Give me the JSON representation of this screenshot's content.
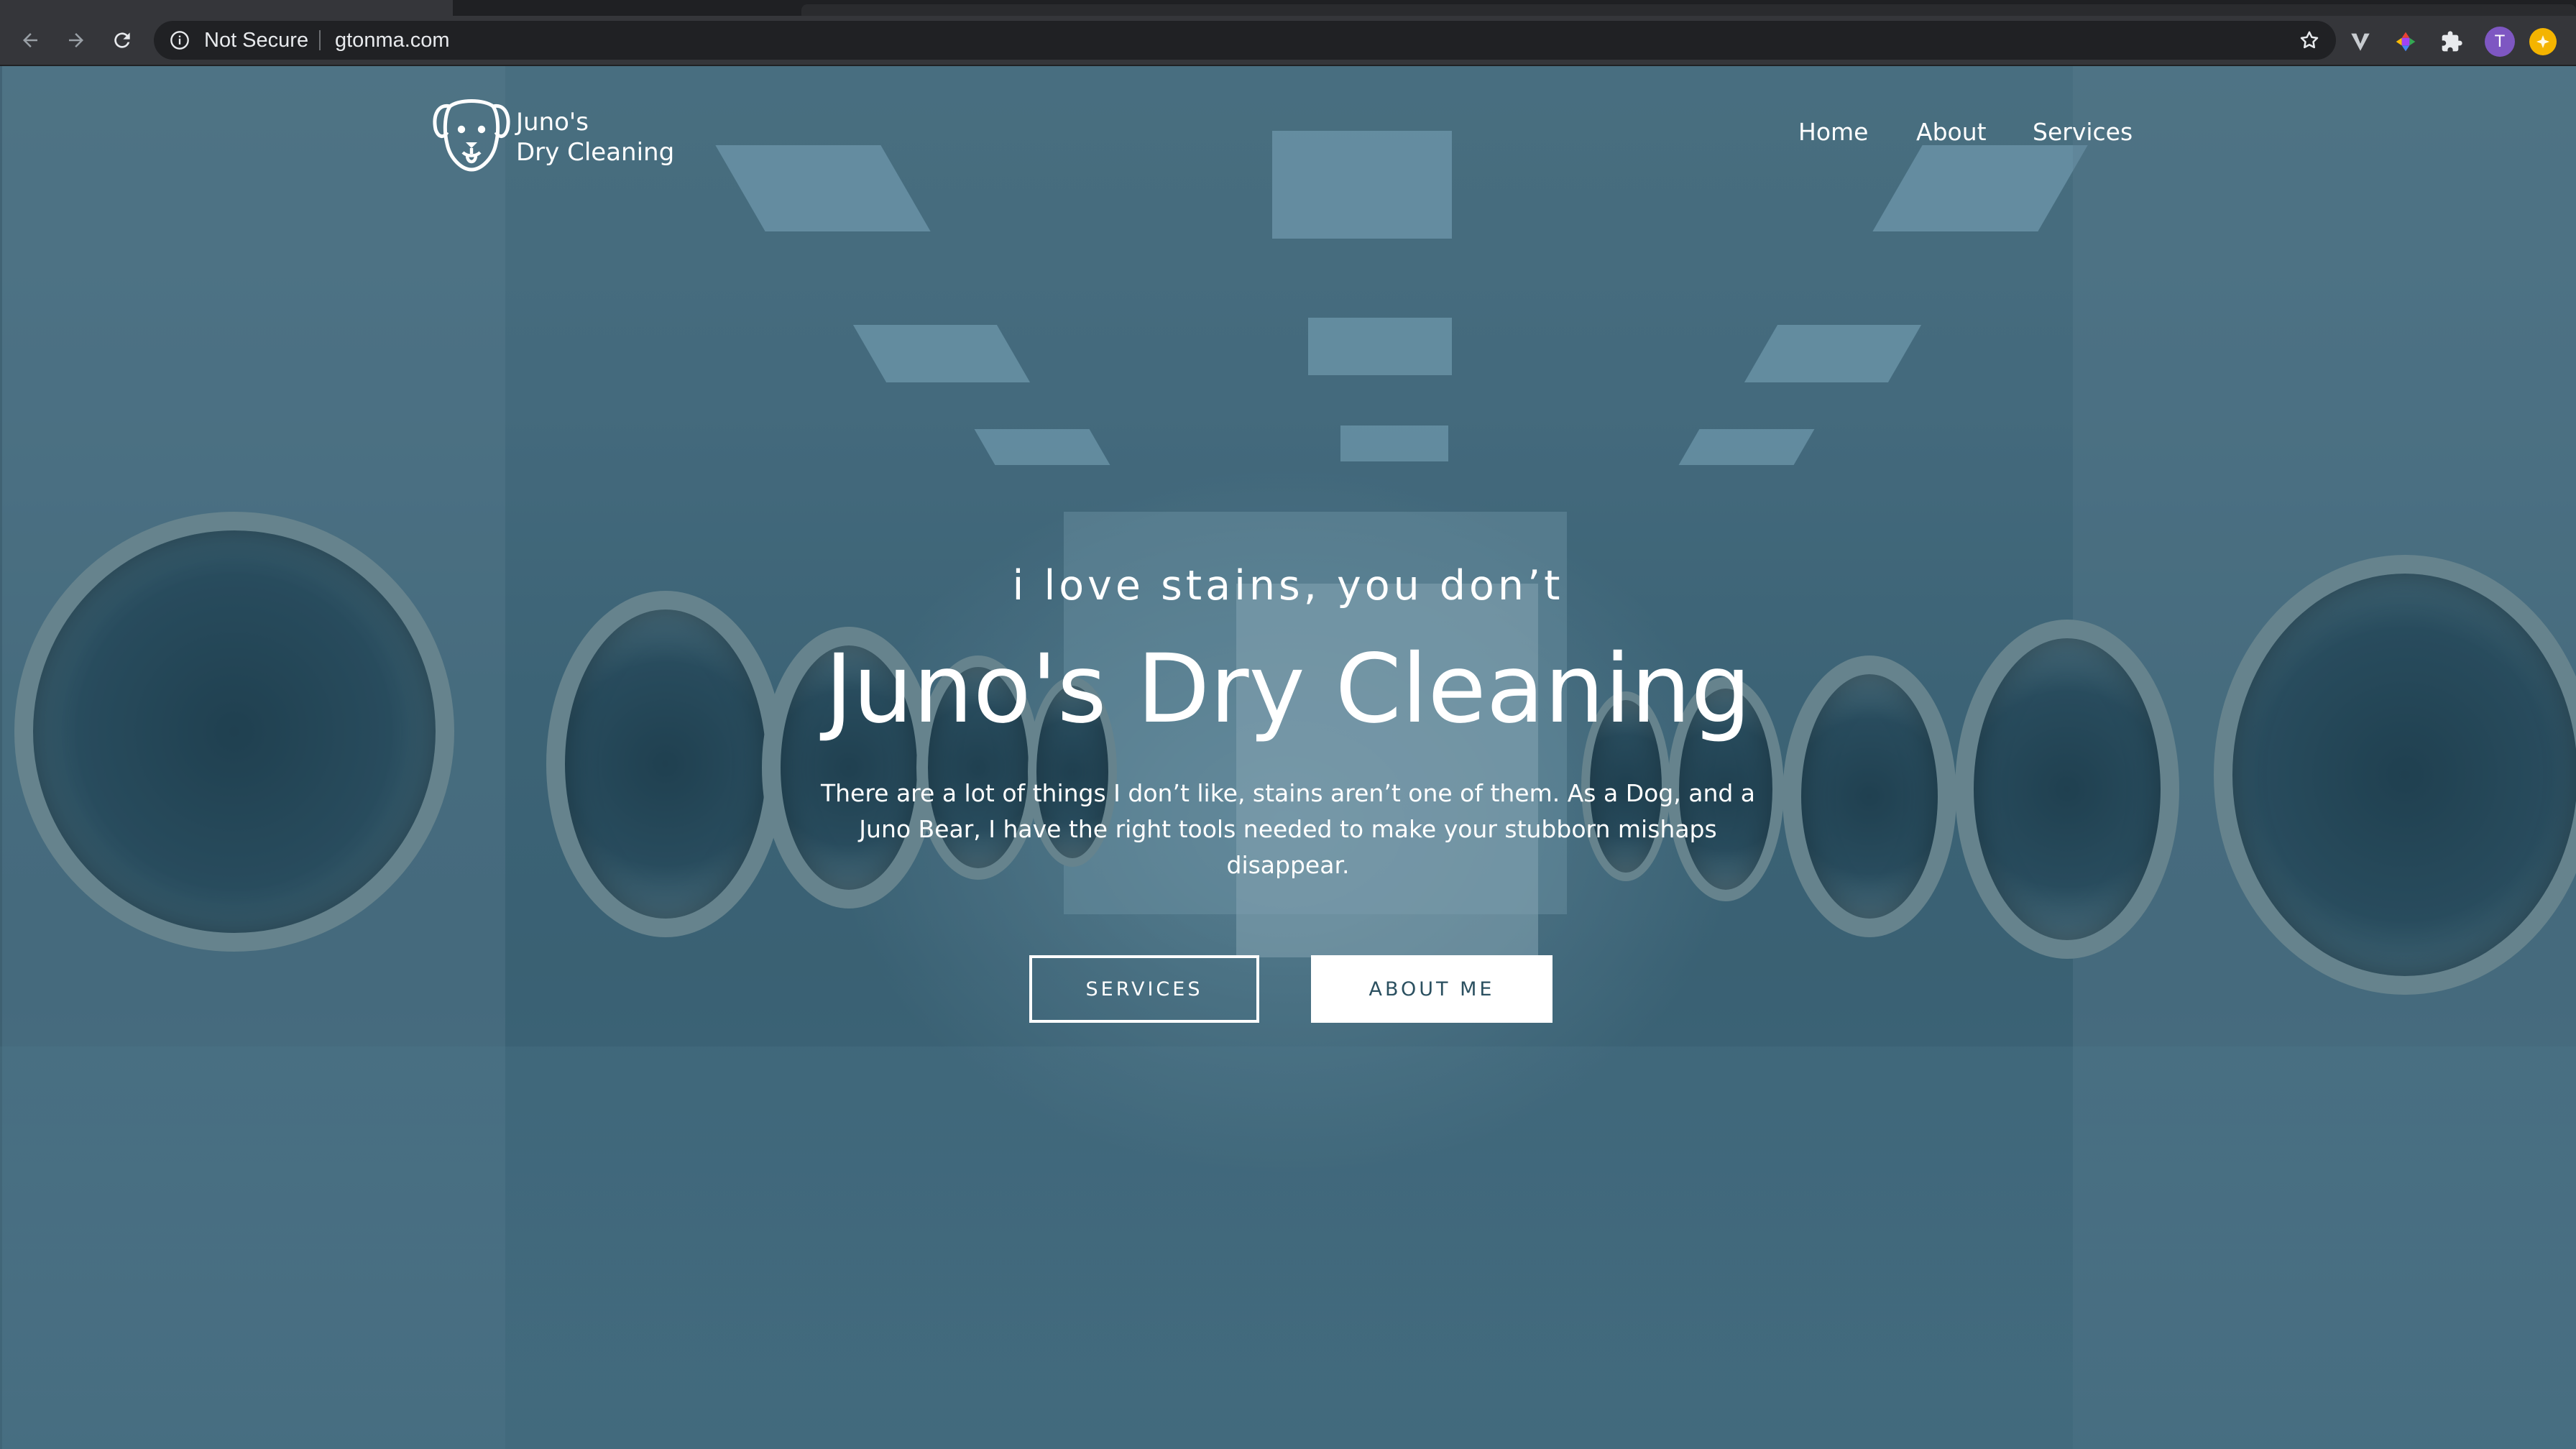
{
  "browser": {
    "security_label": "Not Secure",
    "url": "gtonma.com",
    "profile_initial": "T",
    "icons": [
      "back-arrow-icon",
      "forward-arrow-icon",
      "reload-icon",
      "info-icon",
      "star-icon",
      "vivaldi-extension-icon",
      "color-wheel-extension-icon",
      "puzzle-extension-icon",
      "profile-avatar",
      "coin-extension-icon"
    ]
  },
  "site": {
    "logo": {
      "line1": "Juno's",
      "line2": "Dry Cleaning",
      "icon": "dog-face-icon"
    },
    "nav": [
      "Home",
      "About",
      "Services"
    ],
    "hero": {
      "tagline": "i love stains, you don’t",
      "title": "Juno's Dry Cleaning",
      "description": "There are a lot of things I don’t like, stains aren’t one of them. As a Dog, and a Juno Bear, I have the right tools needed to make your stubborn mishaps disappear.",
      "buttons": {
        "services": "SERVICES",
        "about": "ABOUT ME"
      }
    }
  },
  "colors": {
    "chrome_bg": "#35363a",
    "omnibox_bg": "#202124",
    "hero_tint": "#3d5a6a",
    "button_text": "#2b5060"
  }
}
